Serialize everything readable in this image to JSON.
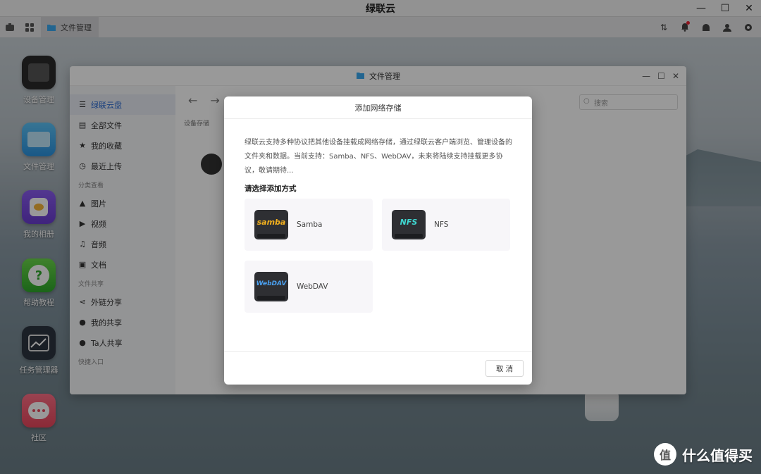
{
  "os_window": {
    "title": "绿联云"
  },
  "taskbar": {
    "open_app_label": "文件管理"
  },
  "desktop_icons": [
    {
      "label": "设备管理",
      "icon": "device-manager-icon",
      "color": "#2b2b2b"
    },
    {
      "label": "文件管理",
      "icon": "folder-icon",
      "color": "#3aa8f0"
    },
    {
      "label": "我的相册",
      "icon": "album-icon",
      "color": "#7b4be0"
    },
    {
      "label": "帮助教程",
      "icon": "help-icon",
      "color": "#3fbf3b"
    },
    {
      "label": "任务管理器",
      "icon": "task-manager-icon",
      "color": "#2c3440"
    },
    {
      "label": "社区",
      "icon": "community-icon",
      "color": "#f0536a"
    }
  ],
  "file_manager": {
    "title": "文件管理",
    "sidebar": {
      "items_top": [
        {
          "label": "绿联云盘",
          "icon": "drive-icon",
          "active": true
        },
        {
          "label": "全部文件",
          "icon": "all-files-icon",
          "active": false
        },
        {
          "label": "我的收藏",
          "icon": "star-icon",
          "active": false
        },
        {
          "label": "最近上传",
          "icon": "clock-icon",
          "active": false
        }
      ],
      "section_category": "分类查看",
      "items_category": [
        {
          "label": "图片",
          "icon": "image-icon"
        },
        {
          "label": "视频",
          "icon": "video-icon"
        },
        {
          "label": "音频",
          "icon": "headphones-icon"
        },
        {
          "label": "文档",
          "icon": "document-icon"
        }
      ],
      "section_share": "文件共享",
      "items_share": [
        {
          "label": "外链分享",
          "icon": "share-icon"
        },
        {
          "label": "我的共享",
          "icon": "user-share-icon"
        },
        {
          "label": "Ta人共享",
          "icon": "users-icon"
        }
      ],
      "section_quick": "快捷入口"
    },
    "search_placeholder": "搜索",
    "breadcrumb": "设备存储"
  },
  "dialog": {
    "title": "添加网络存储",
    "description": "绿联云支持多种协议把其他设备挂载成网络存储，通过绿联云客户端浏览、管理设备的文件夹和数据。当前支持：Samba、NFS、WebDAV，未来将陆续支持挂载更多协议，敬请期待...",
    "subtitle": "请选择添加方式",
    "protocols": [
      {
        "label": "Samba",
        "badge": "samba",
        "badge_color": "#f2b01e"
      },
      {
        "label": "NFS",
        "badge": "NFS",
        "badge_color": "#3fd6d0"
      },
      {
        "label": "WebDAV",
        "badge": "WebDAV",
        "badge_color": "#4aa0f0"
      }
    ],
    "cancel_label": "取 消"
  },
  "watermark": {
    "logo": "值",
    "text": "什么值得买"
  }
}
